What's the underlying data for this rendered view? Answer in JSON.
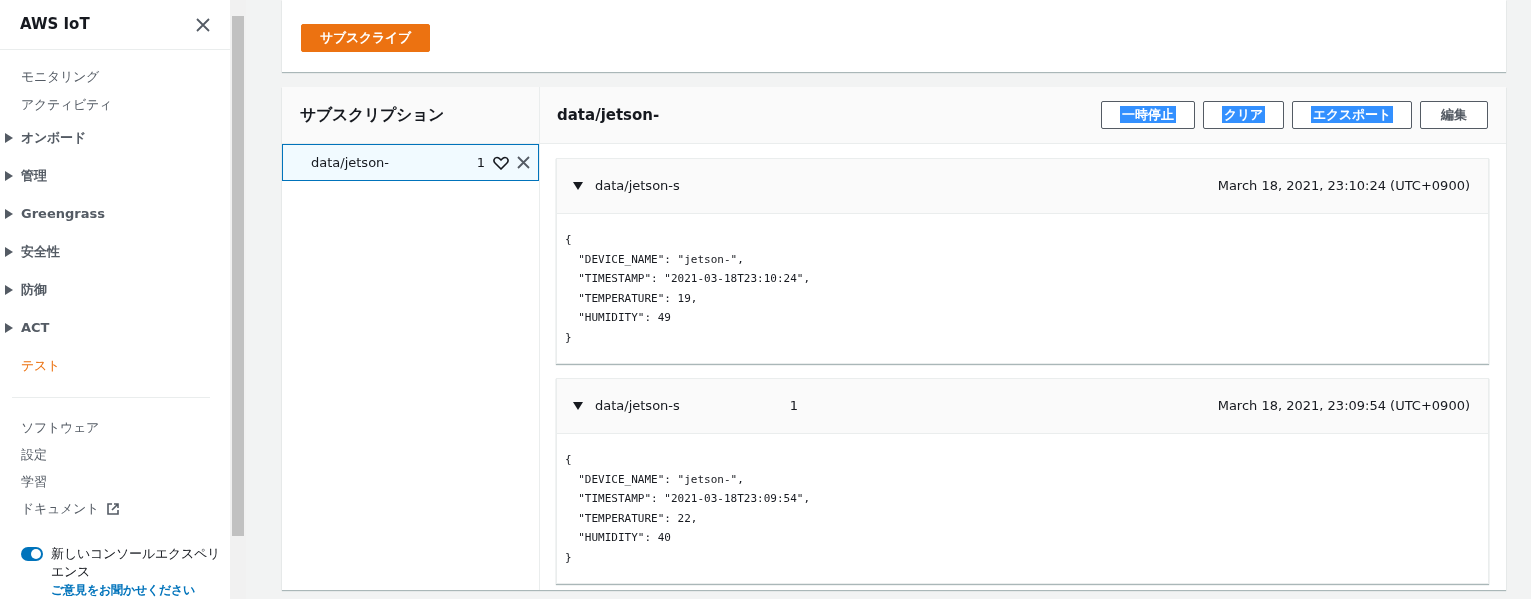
{
  "sidebar": {
    "title": "AWS IoT",
    "items": [
      {
        "label": "モニタリング",
        "kind": "link",
        "selected": false
      },
      {
        "label": "アクティビティ",
        "kind": "link",
        "selected": false
      },
      {
        "label": "オンボード",
        "kind": "group",
        "expanded": false,
        "selected": false
      },
      {
        "label": "管理",
        "kind": "group",
        "expanded": false,
        "selected": false
      },
      {
        "label": "Greengrass",
        "kind": "group",
        "expanded": false,
        "selected": false
      },
      {
        "label": "安全性",
        "kind": "group",
        "expanded": false,
        "selected": false
      },
      {
        "label": "防御",
        "kind": "group",
        "expanded": false,
        "selected": false
      },
      {
        "label": "ACT",
        "kind": "group",
        "expanded": false,
        "selected": false
      },
      {
        "label": "テスト",
        "kind": "link",
        "selected": true
      }
    ],
    "footer_items": [
      {
        "label": "ソフトウェア",
        "kind": "link"
      },
      {
        "label": "設定",
        "kind": "link"
      },
      {
        "label": "学習",
        "kind": "link"
      },
      {
        "label": "ドキュメント",
        "kind": "external"
      }
    ],
    "toggle": {
      "label": "新しいコンソールエクスペリエンス",
      "on": true
    },
    "feedback_link": "ご意見をお聞かせください"
  },
  "subscribe_button": "サブスクライブ",
  "subscriptions": {
    "title": "サブスクリプション",
    "items": [
      {
        "topic": "data/jetson-",
        "suffix": "1",
        "selected": true
      }
    ]
  },
  "topic_panel": {
    "title": "data/jetson-",
    "buttons": [
      {
        "label": "一時停止",
        "text_selected": true
      },
      {
        "label": "クリア",
        "text_selected": true
      },
      {
        "label": "エクスポート",
        "text_selected": true
      },
      {
        "label": "編集",
        "text_selected": false
      }
    ],
    "messages": [
      {
        "topic": "data/jetson-s",
        "expanded": true,
        "time": "March 18, 2021, 23:10:24 (UTC+0900)",
        "body": [
          "{",
          "  \"DEVICE_NAME\": \"jetson-\",",
          "  \"TIMESTAMP\": \"2021-03-18T23:10:24\",",
          "  \"TEMPERATURE\": 19,",
          "  \"HUMIDITY\": 49",
          "}"
        ]
      },
      {
        "topic": "data/jetson-s",
        "suffix": "1",
        "expanded": true,
        "time": "March 18, 2021, 23:09:54 (UTC+0900)",
        "body": [
          "{",
          "  \"DEVICE_NAME\": \"jetson-\",",
          "  \"TIMESTAMP\": \"2021-03-18T23:09:54\",",
          "  \"TEMPERATURE\": 22,",
          "  \"HUMIDITY\": 40",
          "}"
        ]
      }
    ]
  }
}
